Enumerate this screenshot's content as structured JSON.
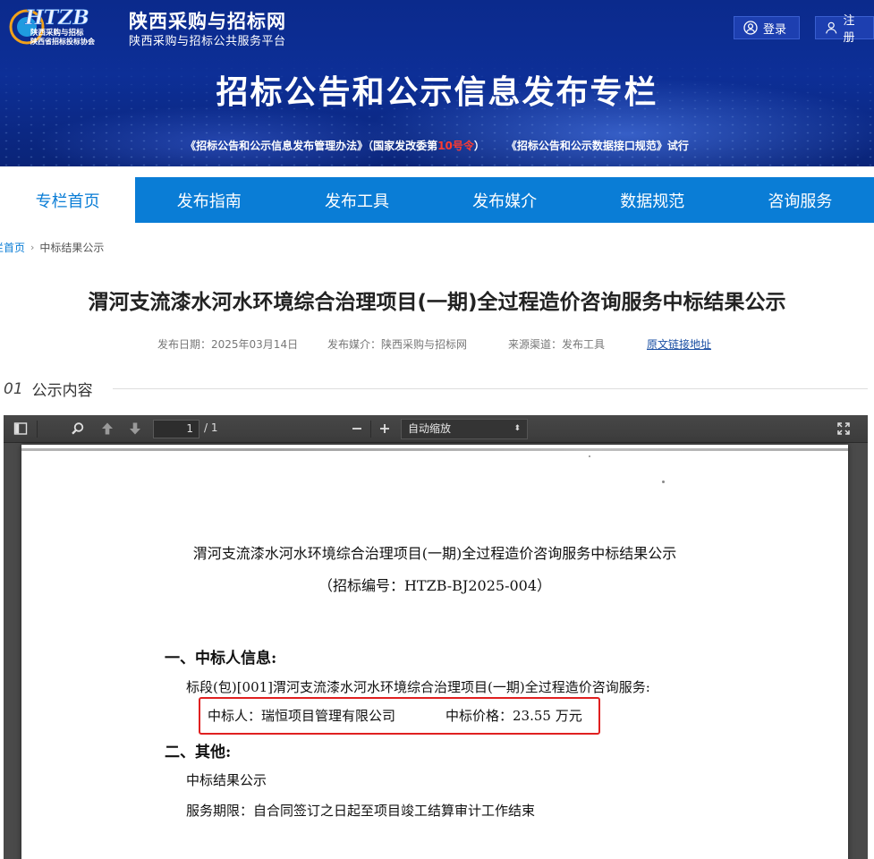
{
  "header": {
    "logo_text": "HTZB",
    "logo_sub1": "陕西采购与招标",
    "logo_sub2": "陕西省招标投标协会",
    "site_name": "陕西采购与招标网",
    "site_subtitle": "陕西采购与招标公共服务平台",
    "login_label": "登录",
    "register_label": "注册",
    "banner_title": "招标公告和公示信息发布专栏",
    "notice_link_1_prefix": "《招标公告和公示信息发布管理办法》（国家发改委第",
    "notice_link_1_red": "10号令",
    "notice_link_1_suffix": "）",
    "notice_link_2": "《招标公告和公示数据接口规范》试行"
  },
  "nav": {
    "items": [
      "专栏首页",
      "发布指南",
      "发布工具",
      "发布媒介",
      "数据规范",
      "咨询服务"
    ],
    "active_index": 0
  },
  "breadcrumb": {
    "home": "栏首页",
    "current": "中标结果公示"
  },
  "article": {
    "title": "渭河支流漆水河水环境综合治理项目(一期)全过程造价咨询服务中标结果公示",
    "date": "发布日期：2025年03月14日",
    "media": "发布媒介：陕西采购与招标网",
    "source": "来源渠道：发布工具",
    "original_link": "原文链接地址"
  },
  "section": {
    "number": "01",
    "label": "公示内容"
  },
  "viewer": {
    "page_current": "1",
    "page_total": "/ 1",
    "zoom": "自动缩放"
  },
  "document": {
    "title": "渭河支流漆水河水环境综合治理项目(一期)全过程造价咨询服务中标结果公示",
    "code": "（招标编号：HTZB-BJ2025-004）",
    "heading1": "一、中标人信息:",
    "lot_line": "标段(包)[001]渭河支流漆水河水环境综合治理项目(一期)全过程造价咨询服务:",
    "winner": "中标人：瑞恒项目管理有限公司",
    "price": "中标价格：23.55 万元",
    "heading2": "二、其他:",
    "other_line1": "中标结果公示",
    "other_line2": "服务期限：自合同签订之日起至项目竣工结算审计工作结束"
  },
  "colors": {
    "nav_blue": "#0a7dd6",
    "banner_blue": "#0d2f97",
    "highlight_red": "#e02020"
  }
}
